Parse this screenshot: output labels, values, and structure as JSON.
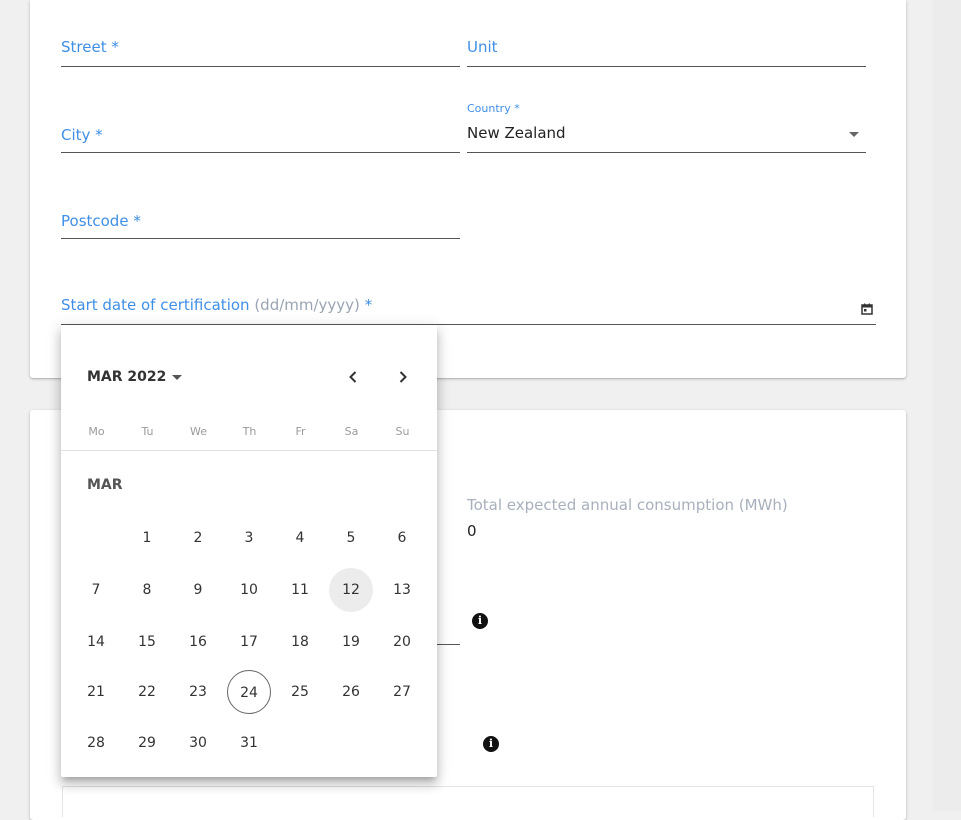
{
  "address_form": {
    "street_label": "Street *",
    "unit_label": "Unit",
    "city_label": "City *",
    "country_small_label": "Country *",
    "country_value": "New Zealand",
    "postcode_label": "Postcode *",
    "start_date_label": "Start date of certification",
    "start_date_hint": "(dd/mm/yyyy)",
    "start_date_required": " *"
  },
  "consumption": {
    "label": "Total expected annual consumption (MWh)",
    "value": "0"
  },
  "info_icons": [
    "i",
    "i"
  ],
  "calendar": {
    "period_label": "MAR 2022",
    "month_label": "MAR",
    "weekdays": [
      "Mo",
      "Tu",
      "We",
      "Th",
      "Fr",
      "Sa",
      "Su"
    ],
    "first_weekday_index": 1,
    "days": [
      "1",
      "2",
      "3",
      "4",
      "5",
      "6",
      "7",
      "8",
      "9",
      "10",
      "11",
      "12",
      "13",
      "14",
      "15",
      "16",
      "17",
      "18",
      "19",
      "20",
      "21",
      "22",
      "23",
      "24",
      "25",
      "26",
      "27",
      "28",
      "29",
      "30",
      "31"
    ],
    "selected_day": "12",
    "today": "24",
    "prev_icon": "chevron-left-icon",
    "next_icon": "chevron-right-icon"
  },
  "colors": {
    "label_blue": "#3f8fe6",
    "hint_grey": "#9aa5b4"
  }
}
